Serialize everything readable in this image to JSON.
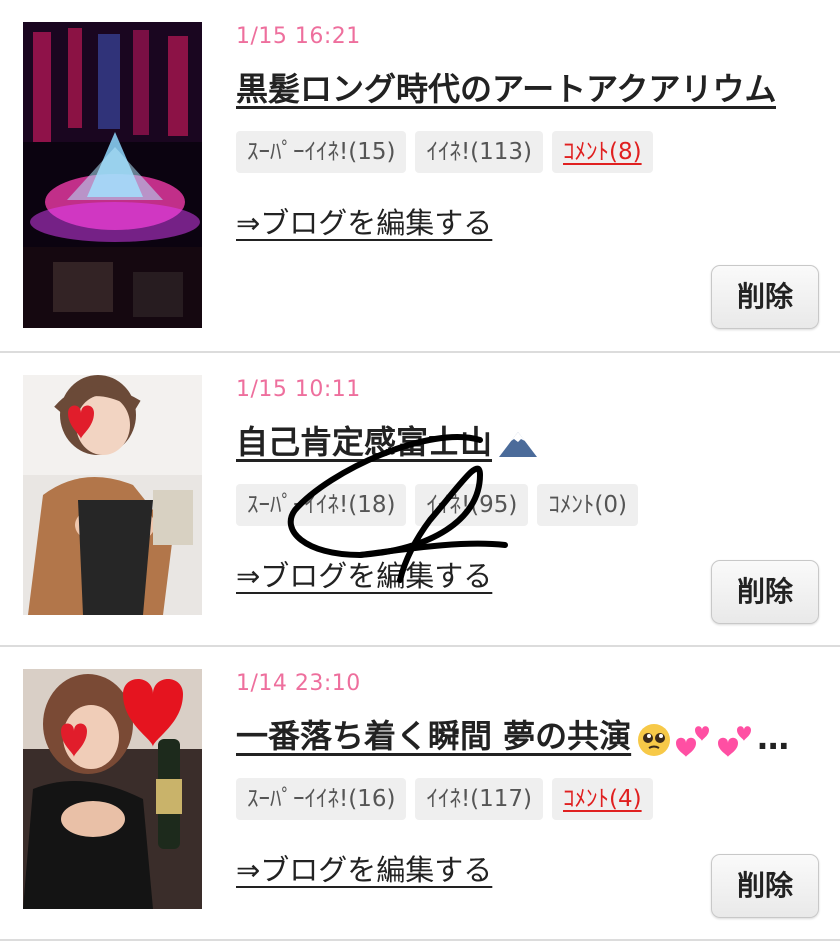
{
  "posts": [
    {
      "date": "1/15 16:21",
      "title": "黒髪ロング時代のアートアクアリウム",
      "super_like": "ｽｰﾊﾟｰｲｲﾈ!(15)",
      "like": "ｲｲﾈ!(113)",
      "comment": "ｺﾒﾝﾄ(8)",
      "edit_link": "⇒ブログを編集する",
      "delete_label": "削除"
    },
    {
      "date": "1/15 10:11",
      "title": "自己肯定感富士山",
      "super_like": "ｽｰﾊﾟｰｲｲﾈ!(18)",
      "like": "ｲｲﾈ!(95)",
      "comment": "ｺﾒﾝﾄ(0)",
      "edit_link": "⇒ブログを編集する",
      "delete_label": "削除"
    },
    {
      "date": "1/14 23:10",
      "title": "一番落ち着く瞬間 夢の共演",
      "super_like": "ｽｰﾊﾟｰｲｲﾈ!(16)",
      "like": "ｲｲﾈ!(117)",
      "comment": "ｺﾒﾝﾄ(4)",
      "edit_link": "⇒ブログを編集する",
      "delete_label": "削除"
    }
  ],
  "colors": {
    "date": "#ee6f9d",
    "comment_active": "#e02020",
    "tag_bg": "#efefef"
  },
  "icons": {
    "post_2_title_emoji": "mount-fuji-icon",
    "post_3_title_emoji": [
      "pleading-face-icon",
      "two-hearts-icon",
      "two-hearts-icon"
    ]
  }
}
